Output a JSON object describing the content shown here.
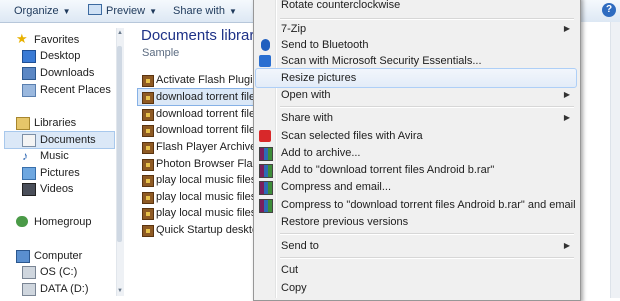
{
  "toolbar": {
    "organize": "Organize",
    "preview": "Preview",
    "share_with": "Share with",
    "help": "?"
  },
  "nav": {
    "favorites": "Favorites",
    "desktop": "Desktop",
    "downloads": "Downloads",
    "recent_places": "Recent Places",
    "libraries": "Libraries",
    "documents": "Documents",
    "music": "Music",
    "pictures": "Pictures",
    "videos": "Videos",
    "homegroup": "Homegroup",
    "computer": "Computer",
    "os_c": "OS (C:)",
    "data_d": "DATA (D:)"
  },
  "library": {
    "title": "Documents librar",
    "subtitle": "Sample"
  },
  "files": [
    "Activate Flash Plugin",
    "download torrent files A",
    "download torrent files A",
    "download torrent files A",
    "Flash Player Archive Pa",
    "Photon Browser Flash N",
    "play local music files Cl",
    "play local music files Cl",
    "play local music files Cl",
    "Quick Startup desktop i"
  ],
  "menu": {
    "rotate": "Rotate counterclockwise",
    "seven_zip": "7-Zip",
    "bluetooth": "Send to Bluetooth",
    "mse": "Scan with Microsoft Security Essentials...",
    "resize": "Resize pictures",
    "open_with": "Open with",
    "share_with": "Share with",
    "avira": "Scan selected files with Avira",
    "add_archive": "Add to archive...",
    "add_rar": "Add to \"download torrent files Android b.rar\"",
    "compress_email": "Compress and email...",
    "compress_rar_email": "Compress to \"download torrent files Android b.rar\" and email",
    "restore": "Restore previous versions",
    "send_to": "Send to",
    "cut": "Cut",
    "copy": "Copy"
  }
}
